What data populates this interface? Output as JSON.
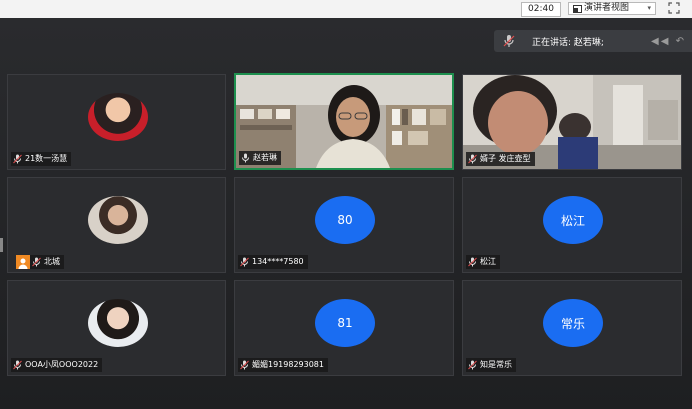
{
  "topbar": {
    "time": "02:40",
    "view_label": "演讲者视图",
    "view_caret": "▾"
  },
  "speaking": {
    "text": "正在讲话: 赵若琳;",
    "arrows": "◀◀ ↶"
  },
  "tiles": [
    {
      "label": "21数一汤慧",
      "type": "avatar"
    },
    {
      "label": "赵若琳",
      "type": "video",
      "active": true
    },
    {
      "label": "婿子  发庄壶型",
      "type": "video"
    },
    {
      "label": "北城",
      "type": "avatar"
    },
    {
      "label": "134****7580",
      "type": "initials",
      "initials": "80"
    },
    {
      "label": "松江",
      "type": "initials",
      "initials": "松江"
    },
    {
      "label": "OOA小凤OOO2022",
      "type": "avatar"
    },
    {
      "label": "媚媚19198293081",
      "type": "initials",
      "initials": "81"
    },
    {
      "label": "知是常乐",
      "type": "initials",
      "initials": "常乐"
    }
  ],
  "colors": {
    "accent_blue": "#1a6df2",
    "active_border": "#1d8f4e",
    "host_badge": "#f08a24"
  },
  "icons": {
    "mic": "microphone-icon",
    "fullscreen": "fullscreen-icon",
    "view": "layout-icon"
  }
}
